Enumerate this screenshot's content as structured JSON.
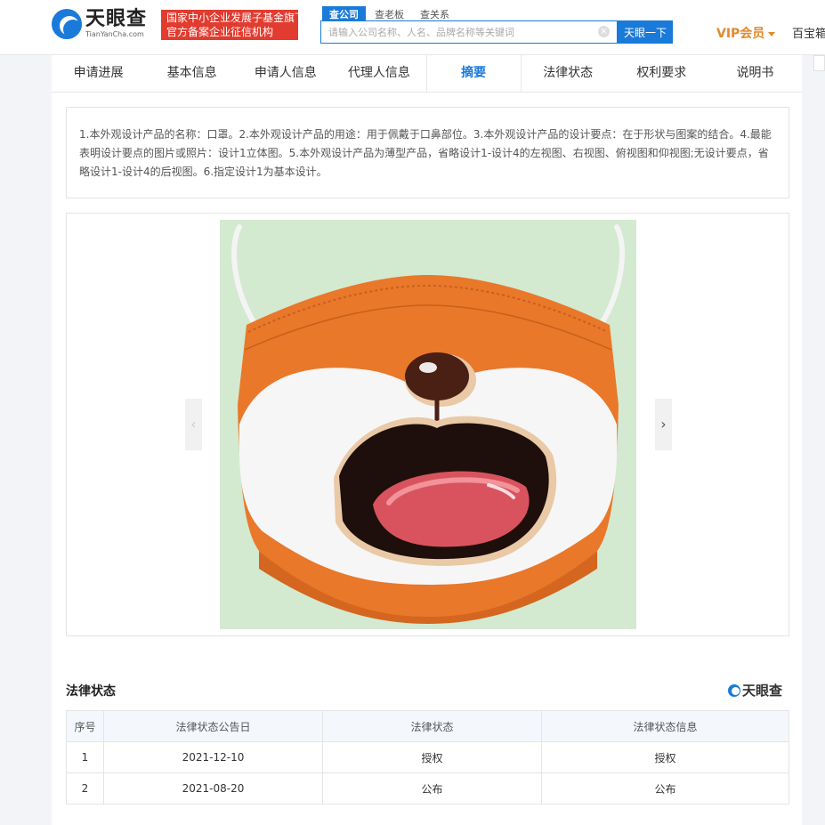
{
  "header": {
    "logo_cn": "天眼查",
    "logo_en": "TianYanCha.com",
    "badge_line1": "国家中小企业发展子基金旗下",
    "badge_line2": "官方备案企业征信机构",
    "search_tabs": [
      "查公司",
      "查老板",
      "查关系"
    ],
    "search_placeholder": "请输入公司名称、人名、品牌名称等关键词",
    "clear_symbol": "×",
    "search_button": "天眼一下",
    "vip_label": "VIP会员",
    "baobox_label": "百宝箱"
  },
  "nav": {
    "items": [
      "申请进展",
      "基本信息",
      "申请人信息",
      "代理人信息",
      "摘要",
      "法律状态",
      "权利要求",
      "说明书"
    ],
    "active_index": 4
  },
  "abstract": {
    "text": "1.本外观设计产品的名称：口罩。2.本外观设计产品的用途：用于佩戴于口鼻部位。3.本外观设计产品的设计要点：在于形状与图案的结合。4.最能表明设计要点的图片或照片：设计1立体图。5.本外观设计产品为薄型产品，省略设计1-设计4的左视图、右视图、俯视图和仰视图;无设计要点，省略设计1-设计4的后视图。6.指定设计1为基本设计。"
  },
  "gallery": {
    "prev_symbol": "‹",
    "next_symbol": "›"
  },
  "legal": {
    "title": "法律状态",
    "logo_text": "天眼查",
    "headers": [
      "序号",
      "法律状态公告日",
      "法律状态",
      "法律状态信息"
    ],
    "rows": [
      [
        "1",
        "2021-12-10",
        "授权",
        "授权"
      ],
      [
        "2",
        "2021-08-20",
        "公布",
        "公布"
      ]
    ]
  },
  "colors": {
    "brand_blue": "#1a7ad9",
    "badge_red": "#e23b2f",
    "vip_orange": "#e08a2a",
    "mask_orange": "#e9782a",
    "image_bg": "#d3ead0"
  }
}
